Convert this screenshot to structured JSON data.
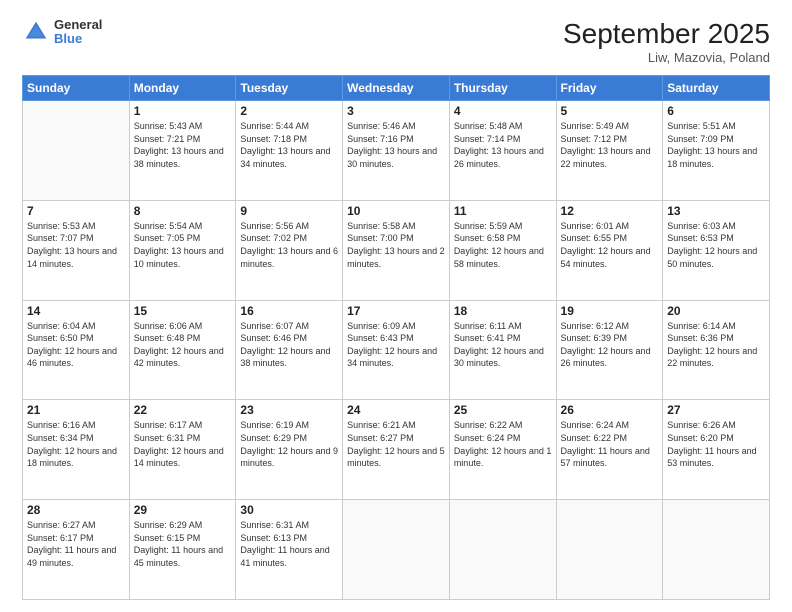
{
  "header": {
    "logo_line1": "General",
    "logo_line2": "Blue",
    "title": "September 2025",
    "subtitle": "Liw, Mazovia, Poland"
  },
  "weekdays": [
    "Sunday",
    "Monday",
    "Tuesday",
    "Wednesday",
    "Thursday",
    "Friday",
    "Saturday"
  ],
  "weeks": [
    [
      {
        "day": "",
        "sunrise": "",
        "sunset": "",
        "daylight": ""
      },
      {
        "day": "1",
        "sunrise": "Sunrise: 5:43 AM",
        "sunset": "Sunset: 7:21 PM",
        "daylight": "Daylight: 13 hours and 38 minutes."
      },
      {
        "day": "2",
        "sunrise": "Sunrise: 5:44 AM",
        "sunset": "Sunset: 7:18 PM",
        "daylight": "Daylight: 13 hours and 34 minutes."
      },
      {
        "day": "3",
        "sunrise": "Sunrise: 5:46 AM",
        "sunset": "Sunset: 7:16 PM",
        "daylight": "Daylight: 13 hours and 30 minutes."
      },
      {
        "day": "4",
        "sunrise": "Sunrise: 5:48 AM",
        "sunset": "Sunset: 7:14 PM",
        "daylight": "Daylight: 13 hours and 26 minutes."
      },
      {
        "day": "5",
        "sunrise": "Sunrise: 5:49 AM",
        "sunset": "Sunset: 7:12 PM",
        "daylight": "Daylight: 13 hours and 22 minutes."
      },
      {
        "day": "6",
        "sunrise": "Sunrise: 5:51 AM",
        "sunset": "Sunset: 7:09 PM",
        "daylight": "Daylight: 13 hours and 18 minutes."
      }
    ],
    [
      {
        "day": "7",
        "sunrise": "Sunrise: 5:53 AM",
        "sunset": "Sunset: 7:07 PM",
        "daylight": "Daylight: 13 hours and 14 minutes."
      },
      {
        "day": "8",
        "sunrise": "Sunrise: 5:54 AM",
        "sunset": "Sunset: 7:05 PM",
        "daylight": "Daylight: 13 hours and 10 minutes."
      },
      {
        "day": "9",
        "sunrise": "Sunrise: 5:56 AM",
        "sunset": "Sunset: 7:02 PM",
        "daylight": "Daylight: 13 hours and 6 minutes."
      },
      {
        "day": "10",
        "sunrise": "Sunrise: 5:58 AM",
        "sunset": "Sunset: 7:00 PM",
        "daylight": "Daylight: 13 hours and 2 minutes."
      },
      {
        "day": "11",
        "sunrise": "Sunrise: 5:59 AM",
        "sunset": "Sunset: 6:58 PM",
        "daylight": "Daylight: 12 hours and 58 minutes."
      },
      {
        "day": "12",
        "sunrise": "Sunrise: 6:01 AM",
        "sunset": "Sunset: 6:55 PM",
        "daylight": "Daylight: 12 hours and 54 minutes."
      },
      {
        "day": "13",
        "sunrise": "Sunrise: 6:03 AM",
        "sunset": "Sunset: 6:53 PM",
        "daylight": "Daylight: 12 hours and 50 minutes."
      }
    ],
    [
      {
        "day": "14",
        "sunrise": "Sunrise: 6:04 AM",
        "sunset": "Sunset: 6:50 PM",
        "daylight": "Daylight: 12 hours and 46 minutes."
      },
      {
        "day": "15",
        "sunrise": "Sunrise: 6:06 AM",
        "sunset": "Sunset: 6:48 PM",
        "daylight": "Daylight: 12 hours and 42 minutes."
      },
      {
        "day": "16",
        "sunrise": "Sunrise: 6:07 AM",
        "sunset": "Sunset: 6:46 PM",
        "daylight": "Daylight: 12 hours and 38 minutes."
      },
      {
        "day": "17",
        "sunrise": "Sunrise: 6:09 AM",
        "sunset": "Sunset: 6:43 PM",
        "daylight": "Daylight: 12 hours and 34 minutes."
      },
      {
        "day": "18",
        "sunrise": "Sunrise: 6:11 AM",
        "sunset": "Sunset: 6:41 PM",
        "daylight": "Daylight: 12 hours and 30 minutes."
      },
      {
        "day": "19",
        "sunrise": "Sunrise: 6:12 AM",
        "sunset": "Sunset: 6:39 PM",
        "daylight": "Daylight: 12 hours and 26 minutes."
      },
      {
        "day": "20",
        "sunrise": "Sunrise: 6:14 AM",
        "sunset": "Sunset: 6:36 PM",
        "daylight": "Daylight: 12 hours and 22 minutes."
      }
    ],
    [
      {
        "day": "21",
        "sunrise": "Sunrise: 6:16 AM",
        "sunset": "Sunset: 6:34 PM",
        "daylight": "Daylight: 12 hours and 18 minutes."
      },
      {
        "day": "22",
        "sunrise": "Sunrise: 6:17 AM",
        "sunset": "Sunset: 6:31 PM",
        "daylight": "Daylight: 12 hours and 14 minutes."
      },
      {
        "day": "23",
        "sunrise": "Sunrise: 6:19 AM",
        "sunset": "Sunset: 6:29 PM",
        "daylight": "Daylight: 12 hours and 9 minutes."
      },
      {
        "day": "24",
        "sunrise": "Sunrise: 6:21 AM",
        "sunset": "Sunset: 6:27 PM",
        "daylight": "Daylight: 12 hours and 5 minutes."
      },
      {
        "day": "25",
        "sunrise": "Sunrise: 6:22 AM",
        "sunset": "Sunset: 6:24 PM",
        "daylight": "Daylight: 12 hours and 1 minute."
      },
      {
        "day": "26",
        "sunrise": "Sunrise: 6:24 AM",
        "sunset": "Sunset: 6:22 PM",
        "daylight": "Daylight: 11 hours and 57 minutes."
      },
      {
        "day": "27",
        "sunrise": "Sunrise: 6:26 AM",
        "sunset": "Sunset: 6:20 PM",
        "daylight": "Daylight: 11 hours and 53 minutes."
      }
    ],
    [
      {
        "day": "28",
        "sunrise": "Sunrise: 6:27 AM",
        "sunset": "Sunset: 6:17 PM",
        "daylight": "Daylight: 11 hours and 49 minutes."
      },
      {
        "day": "29",
        "sunrise": "Sunrise: 6:29 AM",
        "sunset": "Sunset: 6:15 PM",
        "daylight": "Daylight: 11 hours and 45 minutes."
      },
      {
        "day": "30",
        "sunrise": "Sunrise: 6:31 AM",
        "sunset": "Sunset: 6:13 PM",
        "daylight": "Daylight: 11 hours and 41 minutes."
      },
      {
        "day": "",
        "sunrise": "",
        "sunset": "",
        "daylight": ""
      },
      {
        "day": "",
        "sunrise": "",
        "sunset": "",
        "daylight": ""
      },
      {
        "day": "",
        "sunrise": "",
        "sunset": "",
        "daylight": ""
      },
      {
        "day": "",
        "sunrise": "",
        "sunset": "",
        "daylight": ""
      }
    ]
  ]
}
